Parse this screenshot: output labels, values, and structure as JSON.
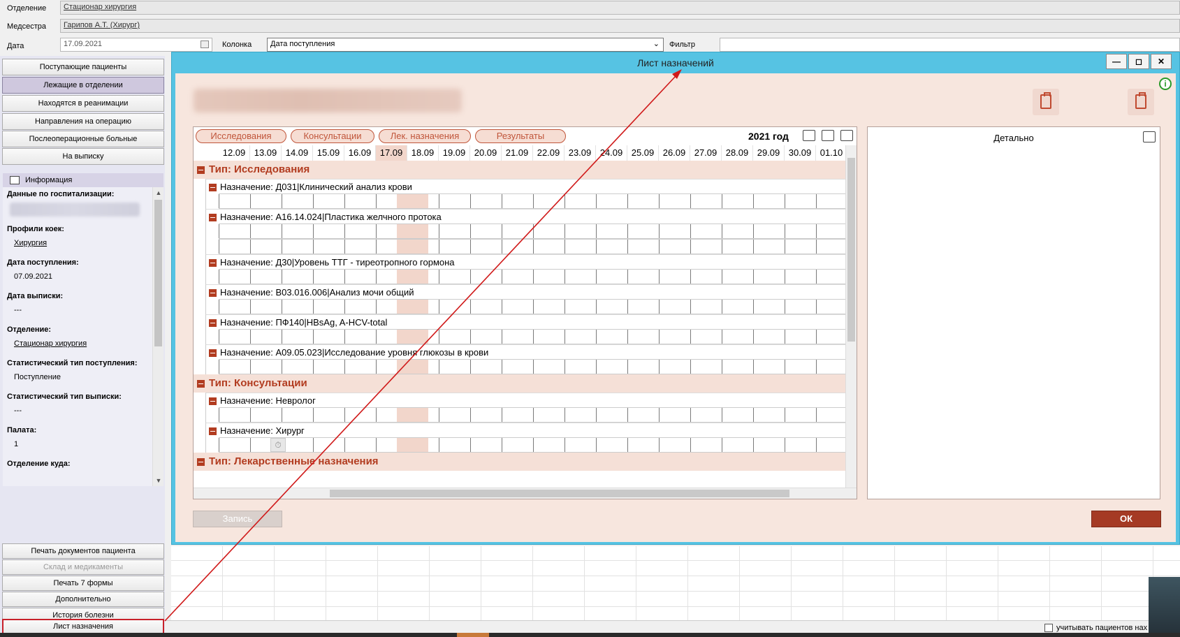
{
  "form": {
    "department_label": "Отделение",
    "department_value": "Стационар хирургия",
    "nurse_label": "Медсестра",
    "nurse_value": "Гарипов А.Т. (Хирург)",
    "date_label": "Дата",
    "date_value": "17.09.2021",
    "column_label": "Колонка",
    "column_value": "Дата поступления",
    "filter_label": "Фильтр",
    "filter_value": ""
  },
  "nav": {
    "items": [
      {
        "label": "Поступающие пациенты"
      },
      {
        "label": "Лежащие в отделении"
      },
      {
        "label": "Находятся в реанимации"
      },
      {
        "label": "Направления на операцию"
      },
      {
        "label": "Послеоперационные больные"
      },
      {
        "label": "На выписку"
      }
    ]
  },
  "info": {
    "header": "Информация",
    "fields": [
      {
        "key": "Данные по госпитализации:",
        "value": ""
      },
      {
        "key": "Профили коек:",
        "value": "Хирургия"
      },
      {
        "key": "Дата поступления:",
        "value": "07.09.2021"
      },
      {
        "key": "Дата выписки:",
        "value": "---"
      },
      {
        "key": "Отделение:",
        "value": "Стационар хирургия"
      },
      {
        "key": "Статистический тип поступления:",
        "value": "Поступление"
      },
      {
        "key": "Статистический тип выписки:",
        "value": "---"
      },
      {
        "key": "Палата:",
        "value": "1"
      },
      {
        "key": "Отделение куда:",
        "value": ""
      }
    ]
  },
  "bottom_nav": {
    "items": [
      {
        "label": "Печать документов пациента"
      },
      {
        "label": "Склад и медикаменты"
      },
      {
        "label": "Печать 7 формы"
      },
      {
        "label": "Дополнительно"
      },
      {
        "label": "История болезни"
      },
      {
        "label": "Лист назначения"
      }
    ]
  },
  "status": {
    "checkbox_label": "учитывать пациентов нах"
  },
  "modal": {
    "title": "Лист назначений",
    "tabs": [
      {
        "label": "Исследования"
      },
      {
        "label": "Консультации"
      },
      {
        "label": "Лек. назначения"
      },
      {
        "label": "Результаты"
      }
    ],
    "year": "2021 год",
    "dates": [
      "12.09",
      "13.09",
      "14.09",
      "15.09",
      "16.09",
      "17.09",
      "18.09",
      "19.09",
      "20.09",
      "21.09",
      "22.09",
      "23.09",
      "24.09",
      "25.09",
      "26.09",
      "27.09",
      "28.09",
      "29.09",
      "30.09",
      "01.10"
    ],
    "groups": [
      {
        "title": "Тип: Исследования",
        "assignments": [
          {
            "label": "Назначение: Д031|Клинический анализ крови",
            "rows": 1
          },
          {
            "label": "Назначение: А16.14.024|Пластика желчного протока",
            "rows": 2
          },
          {
            "label": "Назначение: Д30|Уровень ТТГ - тиреотропного гормона",
            "rows": 1
          },
          {
            "label": "Назначение: В03.016.006|Анализ мочи общий",
            "rows": 1
          },
          {
            "label": "Назначение: ПФ140|HBsAg, A-HCV-total",
            "rows": 1
          },
          {
            "label": "Назначение: А09.05.023|Исследование уровня глюкозы в крови",
            "rows": 1
          }
        ]
      },
      {
        "title": "Тип: Консультации",
        "assignments": [
          {
            "label": "Назначение: Невролог",
            "rows": 1
          },
          {
            "label": "Назначение: Хирург",
            "rows": 1
          }
        ]
      },
      {
        "title": "Тип: Лекарственные назначения",
        "assignments": []
      }
    ],
    "detail_header": "Детально",
    "save_label": "Запись",
    "ok_label": "ОК"
  },
  "icons": {
    "calendar": "calendar-icon",
    "info": "info-icon",
    "print": "print-icon",
    "copy": "copy-icon",
    "add": "add-icon",
    "clipboard_check": "clipboard-check-icon",
    "clipboard_list": "clipboard-list-icon",
    "collapse": "collapse-icon",
    "clock": "clock-icon"
  },
  "colors": {
    "modal_frame": "#56c3e3",
    "modal_body": "#f7e6de",
    "accent": "#b23c20",
    "ok_button": "#a53a24",
    "highlight_border": "#c8202a",
    "annotation_line": "#d01a1a"
  }
}
